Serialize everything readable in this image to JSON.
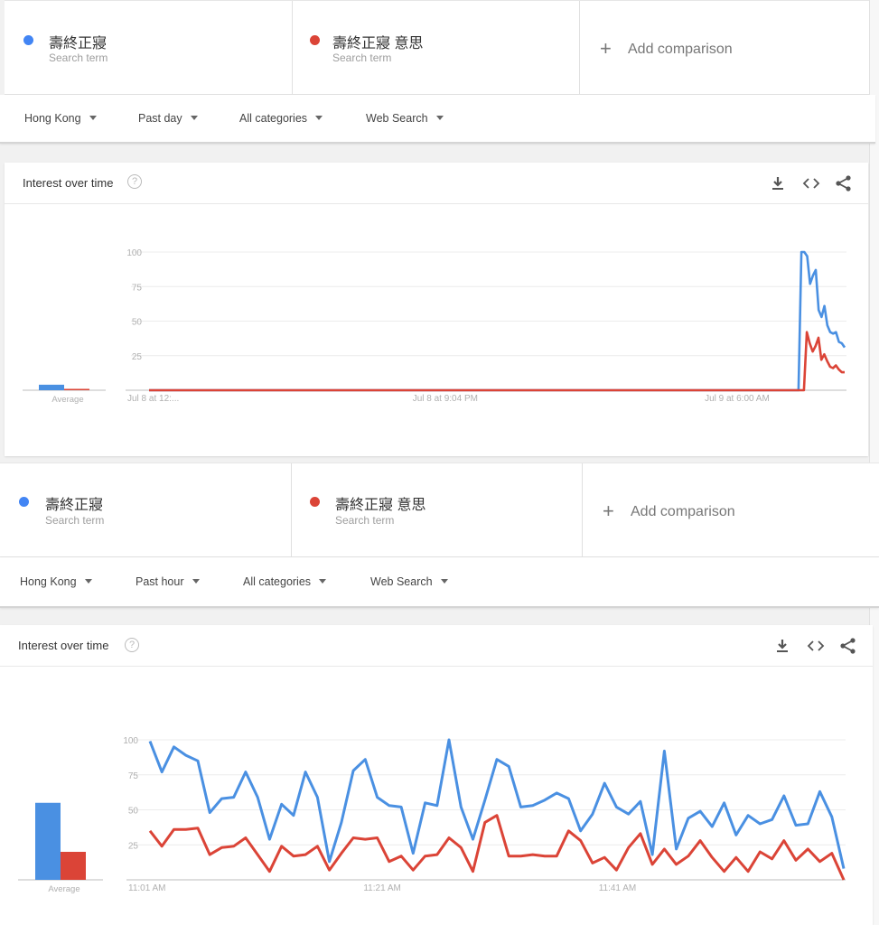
{
  "colors": {
    "blue": "#4a90e2",
    "red": "#db4437",
    "grid": "#ececec",
    "axis": "#bdbdbd",
    "tick_text": "#b0b0b0"
  },
  "panels": [
    {
      "terms": [
        {
          "name": "壽終正寢",
          "sub": "Search term",
          "color": "#4285f4"
        },
        {
          "name": "壽終正寢 意思",
          "sub": "Search term",
          "color": "#db4437"
        }
      ],
      "add_comparison": {
        "icon": "plus-icon",
        "label": "Add comparison"
      },
      "filters": [
        {
          "label": "Hong Kong"
        },
        {
          "label": "Past day"
        },
        {
          "label": "All categories"
        },
        {
          "label": "Web Search"
        }
      ],
      "card": {
        "title": "Interest over time",
        "help_icon": "?",
        "actions": [
          "download-icon",
          "embed-icon",
          "share-icon"
        ]
      }
    },
    {
      "terms": [
        {
          "name": "壽終正寢",
          "sub": "Search term",
          "color": "#4285f4"
        },
        {
          "name": "壽終正寢 意思",
          "sub": "Search term",
          "color": "#db4437"
        }
      ],
      "add_comparison": {
        "icon": "plus-icon",
        "label": "Add comparison"
      },
      "filters": [
        {
          "label": "Hong Kong"
        },
        {
          "label": "Past hour"
        },
        {
          "label": "All categories"
        },
        {
          "label": "Web Search"
        }
      ],
      "card": {
        "title": "Interest over time",
        "help_icon": "?",
        "actions": [
          "download-icon",
          "embed-icon",
          "share-icon"
        ]
      }
    }
  ],
  "chart_data": [
    {
      "type": "line",
      "title": "Interest over time (Past day)",
      "xlabel": "",
      "ylabel": "",
      "ylim": [
        0,
        100
      ],
      "yticks": [
        25,
        50,
        75,
        100
      ],
      "grid": true,
      "x_tick_labels": [
        "Jul 8 at 12:...",
        "Jul 8 at 9:04 PM",
        "Jul 9 at 6:00 AM"
      ],
      "x_tick_positions": [
        0,
        0.41,
        0.83
      ],
      "average": {
        "label": "Average",
        "values": [
          4,
          1
        ]
      },
      "series": [
        {
          "name": "壽終正寢",
          "color": "#4a90e2",
          "values": [
            0,
            0,
            0,
            0,
            0,
            0,
            0,
            0,
            0,
            0,
            0,
            0,
            0,
            0,
            0,
            0,
            0,
            0,
            0,
            0,
            0,
            0,
            0,
            0,
            0,
            0,
            0,
            0,
            0,
            0,
            0,
            0,
            0,
            0,
            0,
            0,
            0,
            0,
            0,
            0,
            0,
            0,
            0,
            0,
            0,
            0,
            0,
            0,
            0,
            0,
            0,
            0,
            0,
            0,
            0,
            0,
            0,
            0,
            0,
            0,
            0,
            0,
            0,
            0,
            0,
            0,
            0,
            0,
            0,
            0,
            0,
            0,
            0,
            0,
            0,
            0,
            0,
            0,
            0,
            0,
            0,
            0,
            0,
            0,
            0,
            0,
            0,
            0,
            0,
            0,
            0,
            0,
            0,
            0,
            0,
            0,
            0,
            0,
            0,
            0,
            0,
            0,
            0,
            0,
            0,
            0,
            0,
            0,
            0,
            0,
            0,
            0,
            0,
            0,
            0,
            0,
            0,
            0,
            0,
            0,
            0,
            0,
            0,
            0,
            0,
            0,
            0,
            0,
            0,
            0,
            0,
            0,
            0,
            0,
            0,
            0,
            0,
            0,
            0,
            0,
            0,
            0,
            0,
            0,
            0,
            0,
            0,
            0,
            0,
            0,
            0,
            0,
            0,
            0,
            0,
            0,
            0,
            0,
            0,
            0,
            0,
            0,
            0,
            0,
            0,
            0,
            0,
            0,
            0,
            0,
            0,
            0,
            0,
            0,
            0,
            0,
            0,
            0,
            0,
            0,
            0,
            0,
            0,
            0,
            0,
            0,
            0,
            0,
            0,
            0,
            0,
            0,
            0,
            0,
            0,
            0,
            0,
            0,
            0,
            0,
            0,
            0,
            0,
            0,
            0,
            0,
            0,
            0,
            0,
            0,
            0,
            0,
            0,
            0,
            0,
            0,
            0,
            0,
            0,
            0,
            0,
            0,
            0,
            0,
            0,
            0,
            100,
            100,
            97,
            77,
            83,
            87,
            58,
            53,
            61,
            47,
            42,
            41,
            42,
            35,
            34,
            31
          ]
        },
        {
          "name": "壽終正寢 意思",
          "color": "#db4437",
          "values": [
            0,
            0,
            0,
            0,
            0,
            0,
            0,
            0,
            0,
            0,
            0,
            0,
            0,
            0,
            0,
            0,
            0,
            0,
            0,
            0,
            0,
            0,
            0,
            0,
            0,
            0,
            0,
            0,
            0,
            0,
            0,
            0,
            0,
            0,
            0,
            0,
            0,
            0,
            0,
            0,
            0,
            0,
            0,
            0,
            0,
            0,
            0,
            0,
            0,
            0,
            0,
            0,
            0,
            0,
            0,
            0,
            0,
            0,
            0,
            0,
            0,
            0,
            0,
            0,
            0,
            0,
            0,
            0,
            0,
            0,
            0,
            0,
            0,
            0,
            0,
            0,
            0,
            0,
            0,
            0,
            0,
            0,
            0,
            0,
            0,
            0,
            0,
            0,
            0,
            0,
            0,
            0,
            0,
            0,
            0,
            0,
            0,
            0,
            0,
            0,
            0,
            0,
            0,
            0,
            0,
            0,
            0,
            0,
            0,
            0,
            0,
            0,
            0,
            0,
            0,
            0,
            0,
            0,
            0,
            0,
            0,
            0,
            0,
            0,
            0,
            0,
            0,
            0,
            0,
            0,
            0,
            0,
            0,
            0,
            0,
            0,
            0,
            0,
            0,
            0,
            0,
            0,
            0,
            0,
            0,
            0,
            0,
            0,
            0,
            0,
            0,
            0,
            0,
            0,
            0,
            0,
            0,
            0,
            0,
            0,
            0,
            0,
            0,
            0,
            0,
            0,
            0,
            0,
            0,
            0,
            0,
            0,
            0,
            0,
            0,
            0,
            0,
            0,
            0,
            0,
            0,
            0,
            0,
            0,
            0,
            0,
            0,
            0,
            0,
            0,
            0,
            0,
            0,
            0,
            0,
            0,
            0,
            0,
            0,
            0,
            0,
            0,
            0,
            0,
            0,
            0,
            0,
            0,
            0,
            0,
            0,
            0,
            0,
            0,
            0,
            0,
            0,
            0,
            0,
            0,
            0,
            0,
            0,
            0,
            0,
            0,
            42,
            34,
            28,
            32,
            38,
            22,
            26,
            21,
            17,
            16,
            18,
            15,
            13,
            13
          ]
        }
      ]
    },
    {
      "type": "line",
      "title": "Interest over time (Past hour)",
      "xlabel": "",
      "ylabel": "",
      "ylim": [
        0,
        100
      ],
      "yticks": [
        25,
        50,
        75,
        100
      ],
      "grid": true,
      "x_tick_labels": [
        "11:01 AM",
        "11:21 AM",
        "11:41 AM"
      ],
      "x_tick_positions": [
        0,
        0.339,
        0.678
      ],
      "average": {
        "label": "Average",
        "values": [
          55,
          20
        ]
      },
      "series": [
        {
          "name": "壽終正寢",
          "color": "#4a90e2",
          "values": [
            99,
            77,
            95,
            89,
            85,
            48,
            58,
            59,
            77,
            59,
            29,
            54,
            46,
            77,
            59,
            13,
            41,
            78,
            86,
            59,
            53,
            52,
            19,
            55,
            53,
            100,
            52,
            29,
            57,
            86,
            81,
            52,
            53,
            57,
            62,
            58,
            35,
            47,
            69,
            52,
            47,
            56,
            18,
            92,
            22,
            44,
            49,
            38,
            55,
            32,
            46,
            40,
            43,
            60,
            39,
            40,
            63,
            45,
            8
          ]
        },
        {
          "name": "壽終正寢 意思",
          "color": "#db4437",
          "values": [
            35,
            24,
            36,
            36,
            37,
            18,
            23,
            24,
            30,
            18,
            6,
            24,
            17,
            18,
            24,
            7,
            19,
            30,
            29,
            30,
            13,
            17,
            7,
            17,
            18,
            30,
            23,
            6,
            41,
            46,
            17,
            17,
            18,
            17,
            17,
            35,
            28,
            12,
            16,
            7,
            23,
            33,
            11,
            22,
            11,
            17,
            28,
            16,
            6,
            16,
            6,
            20,
            15,
            28,
            14,
            22,
            13,
            19,
            0
          ]
        }
      ]
    }
  ]
}
